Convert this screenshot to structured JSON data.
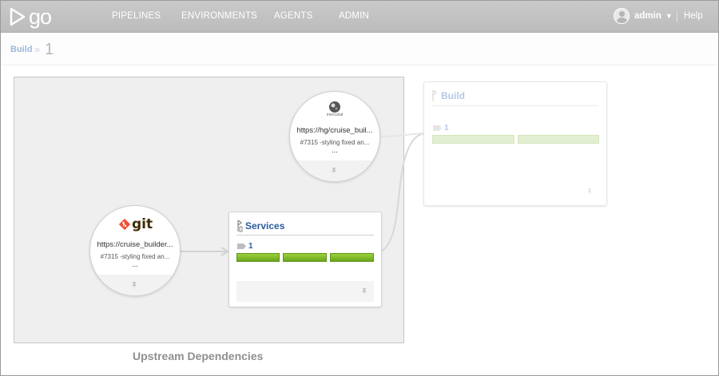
{
  "app": {
    "logo_text": "go"
  },
  "nav": {
    "items": [
      "PIPELINES",
      "ENVIRONMENTS",
      "AGENTS",
      "ADMIN"
    ],
    "user": "admin",
    "help": "Help"
  },
  "breadcrumb": {
    "pipeline": "Build",
    "separator": "»",
    "counter": "1"
  },
  "upstream": {
    "label": "Upstream Dependencies"
  },
  "materials": {
    "git": {
      "logo": "git",
      "url": "https://cruise_builder...",
      "comment": "#7315 -styling fixed an...",
      "more": "..."
    },
    "hg": {
      "logo": "mercurial",
      "url": "https://hg/cruise_buil...",
      "comment": "#7315 -styling fixed an...",
      "more": "..."
    }
  },
  "pipelines": {
    "services": {
      "name": "Services",
      "run": "1",
      "stages": [
        "passed",
        "passed",
        "passed"
      ]
    },
    "build": {
      "name": "Build",
      "run": "1",
      "stages": [
        "passed",
        "passed"
      ]
    }
  },
  "colors": {
    "stage_passed": "#7cb82f",
    "link": "#2c5aa0",
    "git_brand": "#f05033"
  }
}
